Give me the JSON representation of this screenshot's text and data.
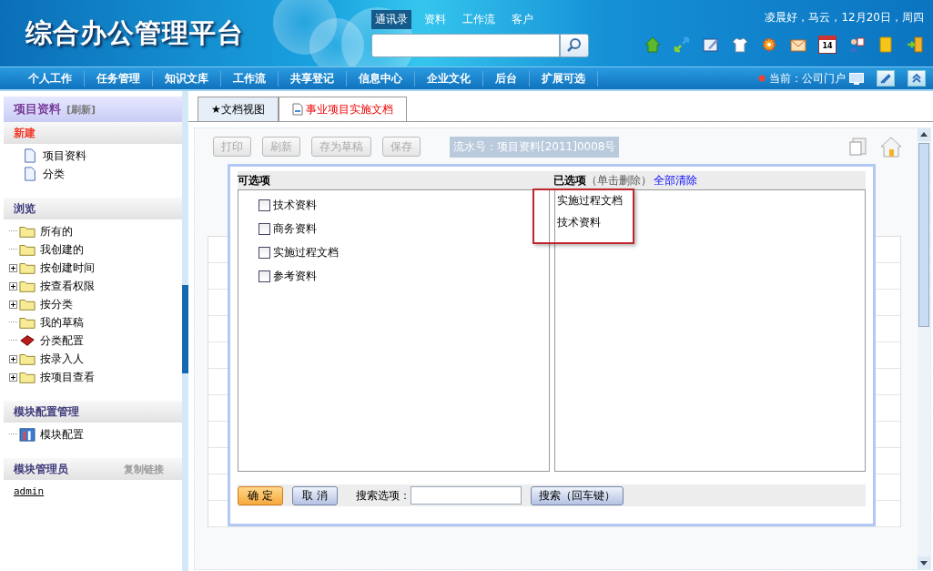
{
  "header": {
    "logo": "综合办公管理平台",
    "greeting": "凌晨好，马云，12月20日，周四",
    "search_tabs": [
      {
        "label": "通讯录",
        "selected": true
      },
      {
        "label": "资料",
        "selected": false
      },
      {
        "label": "工作流",
        "selected": false
      },
      {
        "label": "客户",
        "selected": false
      }
    ],
    "toolbar_icons": [
      {
        "kind": "home"
      },
      {
        "kind": "arrows"
      },
      {
        "kind": "edit"
      },
      {
        "kind": "shirt"
      },
      {
        "kind": "gear"
      },
      {
        "kind": "mail"
      },
      {
        "kind": "calendar",
        "text": "14"
      },
      {
        "kind": "users"
      },
      {
        "kind": "notebook"
      },
      {
        "kind": "exit"
      }
    ]
  },
  "nav": {
    "items": [
      "个人工作",
      "任务管理",
      "知识文库",
      "工作流",
      "共享登记",
      "信息中心",
      "企业文化",
      "后台",
      "扩展可选"
    ],
    "current": "当前：公司门户"
  },
  "sidebar": {
    "title": "项目资料",
    "refresh": "[刷新]",
    "sections": [
      {
        "title": "新建",
        "accent": true,
        "items": [
          {
            "label": "项目资料",
            "kind": "doc",
            "expandable": false
          },
          {
            "label": "分类",
            "kind": "doc",
            "expandable": false
          }
        ]
      },
      {
        "title": "浏览",
        "accent": false,
        "items": [
          {
            "label": "所有的",
            "kind": "folder",
            "expandable": false
          },
          {
            "label": "我创建的",
            "kind": "folder",
            "expandable": false
          },
          {
            "label": "按创建时间",
            "kind": "folder",
            "expandable": true
          },
          {
            "label": "按查看权限",
            "kind": "folder",
            "expandable": true
          },
          {
            "label": "按分类",
            "kind": "folder",
            "expandable": true
          },
          {
            "label": "我的草稿",
            "kind": "folder",
            "expandable": false
          },
          {
            "label": "分类配置",
            "kind": "book",
            "expandable": false
          },
          {
            "label": "按录入人",
            "kind": "folder",
            "expandable": true
          },
          {
            "label": "按项目查看",
            "kind": "folder",
            "expandable": true
          }
        ]
      },
      {
        "title": "模块配置管理",
        "accent": false,
        "items": [
          {
            "label": "模块配置",
            "kind": "tools",
            "expandable": false
          }
        ]
      }
    ],
    "admin": {
      "title": "模块管理员",
      "copy_link": "复制链接",
      "user": "admin"
    }
  },
  "tabs": [
    {
      "label": "★文档视图",
      "icon": false,
      "selected": false
    },
    {
      "label": "事业项目实施文档",
      "icon": true,
      "selected": true
    }
  ],
  "toolbar": {
    "buttons": [
      {
        "label": "打印",
        "disabled": true
      },
      {
        "label": "刷新",
        "disabled": true
      },
      {
        "label": "存为草稿",
        "disabled": true
      },
      {
        "label": "保存",
        "disabled": true
      }
    ],
    "serial": "流水号：项目资料[2011]0008号"
  },
  "dialog": {
    "available_title": "可选项",
    "selected_title": "已选项",
    "selected_hint": "（单击删除）",
    "clear_all": "全部清除",
    "available": [
      {
        "label": "技术资料",
        "checked": false
      },
      {
        "label": "商务资料",
        "checked": false
      },
      {
        "label": "实施过程文档",
        "checked": false
      },
      {
        "label": "参考资料",
        "checked": false
      }
    ],
    "selected": [
      "实施过程文档",
      "技术资料"
    ],
    "confirm": "确 定",
    "cancel": "取 消",
    "search_label": "搜索选项：",
    "search_button": "搜索（回车键）"
  }
}
